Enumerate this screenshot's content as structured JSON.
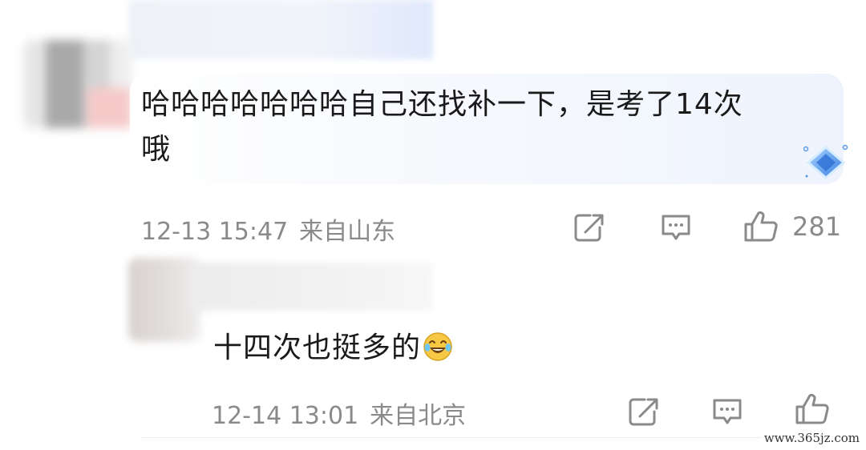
{
  "comments": [
    {
      "text_line1": "哈哈哈哈哈哈哈自己还找补一下，是考了14次",
      "text_line2": "哦",
      "time": "12-13 15:47",
      "location": "来自山东",
      "likes": "281",
      "actions": [
        "share-icon",
        "comment-icon",
        "thumbs-up-icon"
      ]
    },
    {
      "text": "十四次也挺多的",
      "emoji": "laughing-crying-emoji",
      "time": "12-14 13:01",
      "location": "来自北京",
      "actions": [
        "share-icon",
        "comment-icon",
        "thumbs-up-icon"
      ]
    }
  ],
  "badge_icon": "diamond-badge-icon",
  "watermark": "www.365jz.com",
  "colors": {
    "meta_text": "#8a8a8a",
    "body_text": "#1a1a1a",
    "badge_blue": "#4a90e2"
  }
}
